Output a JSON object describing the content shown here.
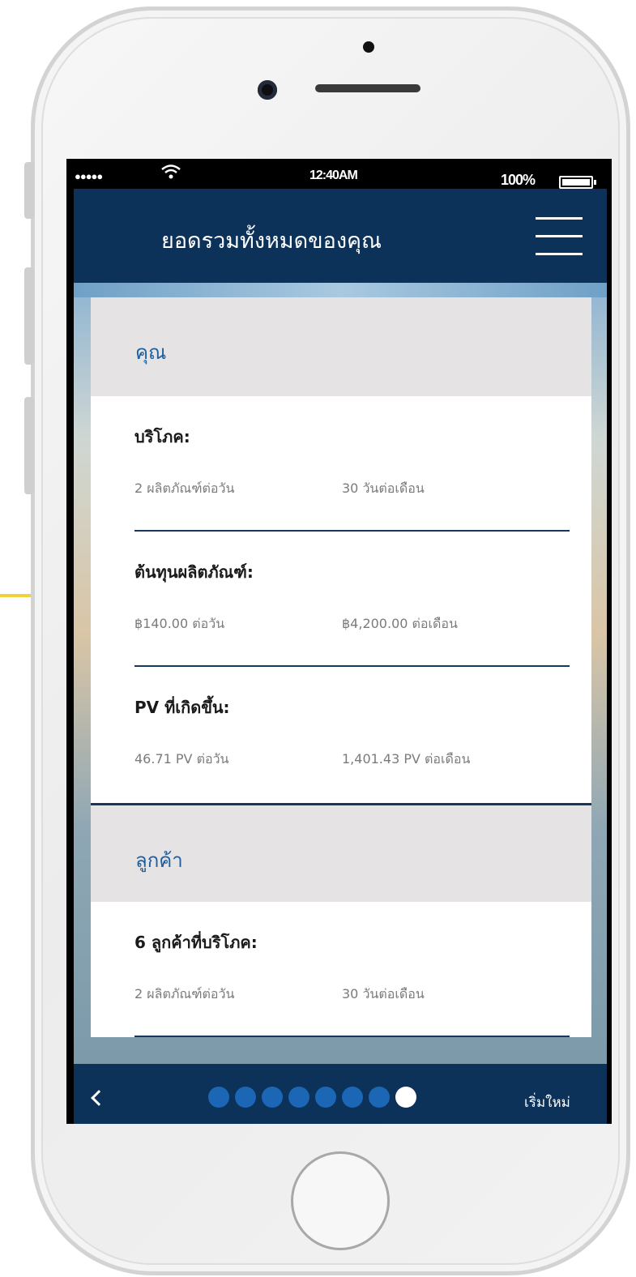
{
  "status_bar": {
    "signal": "●●●●●",
    "time": "12:40AM",
    "battery": "100%"
  },
  "header": {
    "title": "ยอดรวมทั้งหมดของคุณ",
    "menu_icon": "hamburger-menu-icon"
  },
  "sections": [
    {
      "title": "คุณ",
      "items": [
        {
          "label": "บริโภค:",
          "left": "2 ผลิตภัณฑ์ต่อวัน",
          "right": "30 วันต่อเดือน"
        },
        {
          "label": "ต้นทุนผลิตภัณฑ์:",
          "left": "฿140.00 ต่อวัน",
          "right": "฿4,200.00 ต่อเดือน"
        },
        {
          "label": "PV ที่เกิดขึ้น:",
          "left": "46.71 PV ต่อวัน",
          "right": "1,401.43 PV ต่อเดือน"
        }
      ]
    },
    {
      "title": "ลูกค้า",
      "items": [
        {
          "label": "6 ลูกค้าที่บริโภค:",
          "left": "2 ผลิตภัณฑ์ต่อวัน",
          "right": "30 วันต่อเดือน"
        }
      ]
    }
  ],
  "footer": {
    "back_icon": "chevron-left-icon",
    "pager": {
      "total": 8,
      "current": 8
    },
    "restart_label": "เริ่มใหม่"
  },
  "colors": {
    "navy": "#0c325a",
    "section_title": "#1e5f9f",
    "pager_dot": "#1b66b5",
    "accent_yellow": "#f2d13a"
  }
}
